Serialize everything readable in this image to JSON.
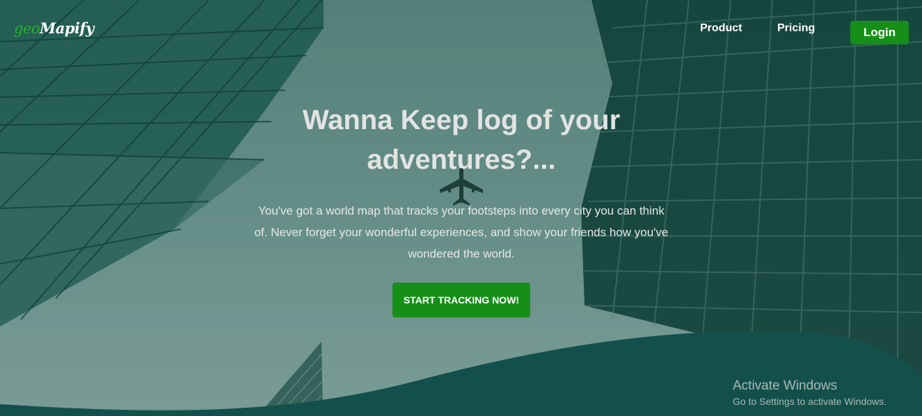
{
  "brand": {
    "prefix": "geo",
    "name": "Mapify"
  },
  "nav": {
    "items": [
      {
        "label": "Product"
      },
      {
        "label": "Pricing"
      }
    ],
    "login_label": "Login"
  },
  "hero": {
    "headline": "Wanna Keep log of your adventures?...",
    "subtext": "You've got a world map that tracks your footsteps into every city you can think of. Never forget your wonderful experiences, and show your friends how you've wondered the world.",
    "cta_label": "START TRACKING NOW!"
  },
  "watermark": {
    "title": "Activate Windows",
    "subtitle": "Go to Settings to activate Windows."
  },
  "colors": {
    "accent": "#168f18",
    "brand_green": "#29b02a",
    "wave": "#13504c"
  }
}
